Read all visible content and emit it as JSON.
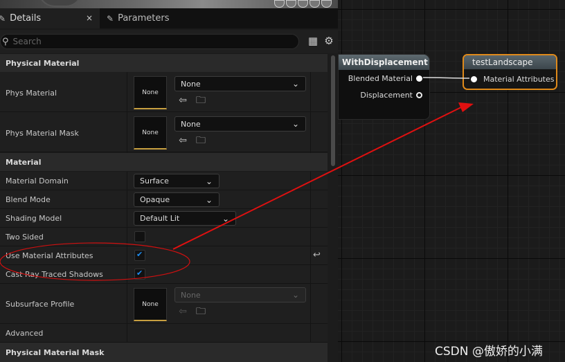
{
  "tabs": {
    "details": "Details",
    "details_close": "×",
    "parameters": "Parameters"
  },
  "search": {
    "placeholder": "Search"
  },
  "sections": {
    "physical_material": "Physical Material",
    "material": "Material",
    "physical_material_mask": "Physical Material Mask"
  },
  "props": {
    "phys_material": {
      "label": "Phys Material",
      "thumb": "None",
      "value": "None"
    },
    "phys_material_mask": {
      "label": "Phys Material Mask",
      "thumb": "None",
      "value": "None"
    },
    "material_domain": {
      "label": "Material Domain",
      "value": "Surface"
    },
    "blend_mode": {
      "label": "Blend Mode",
      "value": "Opaque"
    },
    "shading_model": {
      "label": "Shading Model",
      "value": "Default Lit"
    },
    "two_sided": {
      "label": "Two Sided",
      "checked": false
    },
    "use_material_attributes": {
      "label": "Use Material Attributes",
      "checked": true
    },
    "cast_ray_traced_shadows": {
      "label": "Cast Ray Traced Shadows",
      "checked": true
    },
    "subsurface_profile": {
      "label": "Subsurface Profile",
      "thumb": "None",
      "value": "None"
    },
    "advanced": {
      "label": "Advanced"
    }
  },
  "graph": {
    "node1": {
      "title": "WithDisplacement",
      "pins": [
        "Blended Material",
        "Displacement"
      ]
    },
    "node2": {
      "title": "testLandscape",
      "pin": "Material Attributes"
    },
    "annotation_color": "#e01010",
    "node_highlight": "#e08a1a"
  },
  "watermark": "CSDN @傲娇的小满"
}
